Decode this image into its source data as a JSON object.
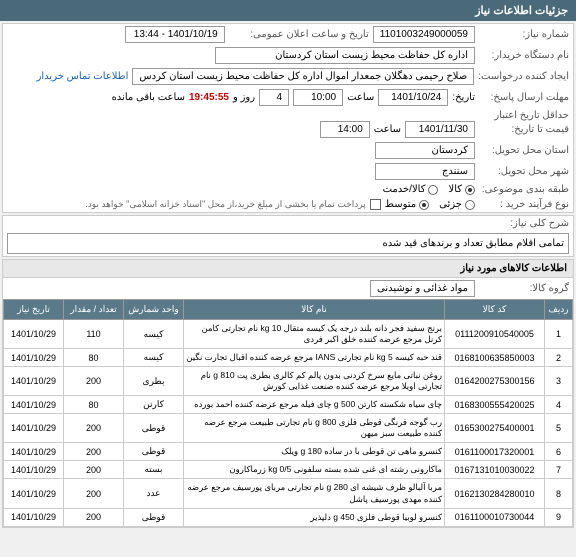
{
  "header": "جزئیات اطلاعات نیاز",
  "fields": {
    "niaz_no_label": "شماره نیاز:",
    "niaz_no": "1101003249000059",
    "announce_label": "تاریخ و ساعت اعلان عمومی:",
    "announce": "1401/10/19 - 13:44",
    "buyer_label": "نام دستگاه خریدار:",
    "buyer": "اداره کل حفاظت محیط زیست استان کردستان",
    "creator_label": "ایجاد کننده درخواست:",
    "creator": "صلاح رحیمی دهگلان جمعدار اموال اداره کل حفاظت محیط زیست استان کردس",
    "contact_link": "اطلاعات تماس خریدار",
    "deadline_label": "مهلت ارسال پاسخ:",
    "deadline_date_label": "تاریخ:",
    "deadline_date": "1401/10/24",
    "deadline_time_label": "ساعت",
    "deadline_time": "10:00",
    "remaining_days": "4",
    "remaining_days_label": "روز و",
    "remaining_time": "19:45:55",
    "remaining_label": "ساعت باقی مانده",
    "validity_label": "حداقل تاریخ اعتبار",
    "validity_label2": "قیمت تا تاریخ:",
    "validity_date": "1401/11/30",
    "validity_time": "14:00",
    "province_label": "استان محل تحویل:",
    "province": "کردستان",
    "city_label": "شهر محل تحویل:",
    "city": "سنندج",
    "category_label": "طبقه بندی موضوعی:",
    "cat_goods": "کالا",
    "cat_service": "کالا/خدمت",
    "process_label": "نوع فرآیند خرید :",
    "proc_partial": "جزئی",
    "proc_medium": "متوسط",
    "payment_note": "پرداخت تمام یا بخشی از مبلغ خرید،از محل \"اسناد خزانه اسلامی\" خواهد بود.",
    "desc_label": "شرح کلی نیاز:",
    "desc": "تمامی اقلام مطابق تعداد و برندهای قید شده",
    "items_header": "اطلاعات کالاهای مورد نیاز",
    "group_label": "گروه کالا:",
    "group": "مواد غذائی و نوشیدنی"
  },
  "columns": {
    "row": "ردیف",
    "code": "کد کالا",
    "name": "نام کالا",
    "unit": "واحد شمارش",
    "qty": "تعداد / مقدار",
    "date": "تاریخ نیاز"
  },
  "items": [
    {
      "row": "1",
      "code": "0111200910540005",
      "name": "برنج سفید فجر دانه بلند درجه یک کیسه متقال kg 10 نام تجارتی کامن کرنل مرجع عرضه کننده خلق اکبر فردی",
      "unit": "کیسه",
      "qty": "110",
      "date": "1401/10/29"
    },
    {
      "row": "2",
      "code": "0168100635850003",
      "name": "قند حبه کیسه 5 kg نام تجارتی IANS مرجع عرضه کننده اقبال تجارت نگین",
      "unit": "کیسه",
      "qty": "80",
      "date": "1401/10/29"
    },
    {
      "row": "3",
      "code": "0164200275300156",
      "name": "روغن نباتی مایع سرخ کردنی بدون پالم کم کالری بطری پت 810 g نام تجارتی اویلا مرجع عرضه کننده صنعت غذایی کورش",
      "unit": "بطری",
      "qty": "200",
      "date": "1401/10/29"
    },
    {
      "row": "4",
      "code": "0168300555420025",
      "name": "چای سیاه شکسته کارتن 500 g چای فیله مرجع عرضه کننده احمد بورده",
      "unit": "کارتن",
      "qty": "80",
      "date": "1401/10/29"
    },
    {
      "row": "5",
      "code": "0165300275400001",
      "name": "رب گوجه فرنگی قوطی فلزی 800 g نام تجارتی طبیعت مرجع عرضه کننده طبیعت سبز میهن",
      "unit": "قوطی",
      "qty": "200",
      "date": "1401/10/29"
    },
    {
      "row": "6",
      "code": "0161100017320001",
      "name": "کنسرو ماهی تن قوطی با در ساده 180 g ویلک",
      "unit": "قوطی",
      "qty": "200",
      "date": "1401/10/29"
    },
    {
      "row": "7",
      "code": "0167131010030022",
      "name": "ماکارونی رشته ای غنی شده بسته سلفونی kg 0/5 زرماکارون",
      "unit": "بسته",
      "qty": "200",
      "date": "1401/10/29"
    },
    {
      "row": "8",
      "code": "0162130284280010",
      "name": "مربا آلبالو ظرف شیشه ای 280 g نام تجارتی مربای پورسیف مرجع عرضه کننده مهدی پورسیف پاشل",
      "unit": "عدد",
      "qty": "200",
      "date": "1401/10/29"
    },
    {
      "row": "9",
      "code": "0161100010730044",
      "name": "کنسرو لوبیا قوطی فلزی 450 g دلپذیر",
      "unit": "قوطی",
      "qty": "200",
      "date": "1401/10/29"
    }
  ]
}
